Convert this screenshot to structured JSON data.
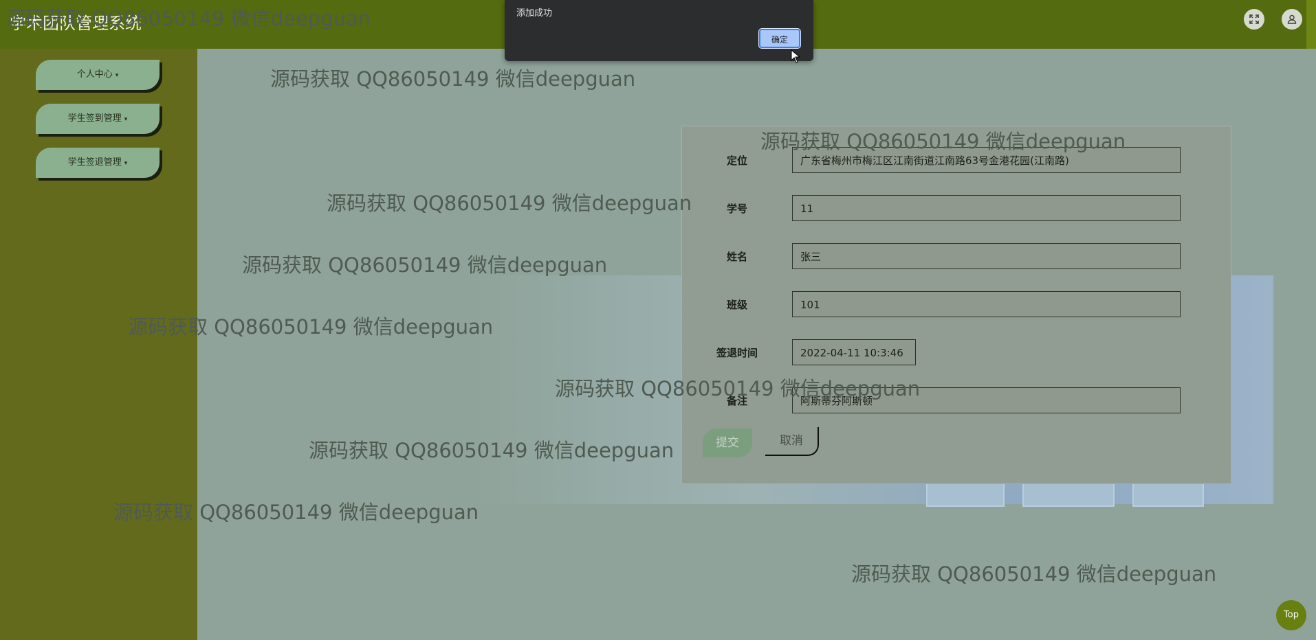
{
  "header": {
    "title": "学术团队管理系统"
  },
  "sidebar": {
    "items": [
      {
        "label": "个人中心"
      },
      {
        "label": "学生签到管理"
      },
      {
        "label": "学生签退管理"
      }
    ]
  },
  "form": {
    "fields": [
      {
        "label": "定位",
        "value": "广东省梅州市梅江区江南街道江南路63号金港花园(江南路)"
      },
      {
        "label": "学号",
        "value": "11"
      },
      {
        "label": "姓名",
        "value": "张三"
      },
      {
        "label": "班级",
        "value": "101"
      },
      {
        "label": "签退时间",
        "value": "2022-04-11 10:3:46"
      },
      {
        "label": "备注",
        "value": "阿斯蒂芬阿斯顿"
      }
    ],
    "submit_label": "提交",
    "cancel_label": "取消"
  },
  "alert": {
    "message": "添加成功",
    "ok_label": "确定"
  },
  "watermark_text": "源码获取 QQ86050149 微信deepguan",
  "top_button_label": "Top",
  "icons": {
    "fullscreen": "fullscreen-icon",
    "user": "user-icon",
    "caret": "caret-down-icon",
    "cursor": "cursor-icon"
  },
  "colors": {
    "header": "#556b0f",
    "sidebar": "#646a1c",
    "menu_item": "#8ab090",
    "alert_button": "#a8c7fa"
  }
}
